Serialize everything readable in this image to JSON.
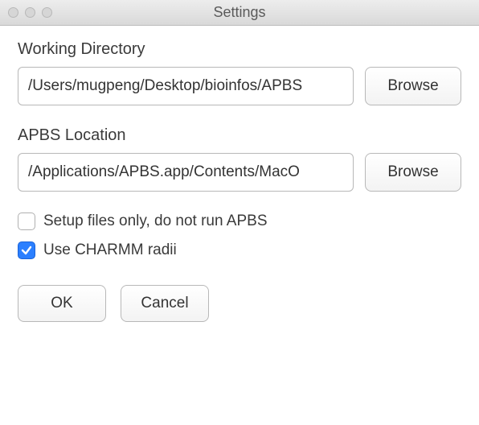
{
  "window": {
    "title": "Settings"
  },
  "workingDirectory": {
    "label": "Working Directory",
    "value": "/Users/mugpeng/Desktop/bioinfos/APBS",
    "browse": "Browse"
  },
  "apbsLocation": {
    "label": "APBS Location",
    "value": "/Applications/APBS.app/Contents/MacO",
    "browse": "Browse"
  },
  "checks": {
    "setupOnly": {
      "label": "Setup files only, do not run APBS",
      "checked": false
    },
    "useCharmm": {
      "label": "Use CHARMM radii",
      "checked": true
    }
  },
  "footer": {
    "ok": "OK",
    "cancel": "Cancel"
  }
}
